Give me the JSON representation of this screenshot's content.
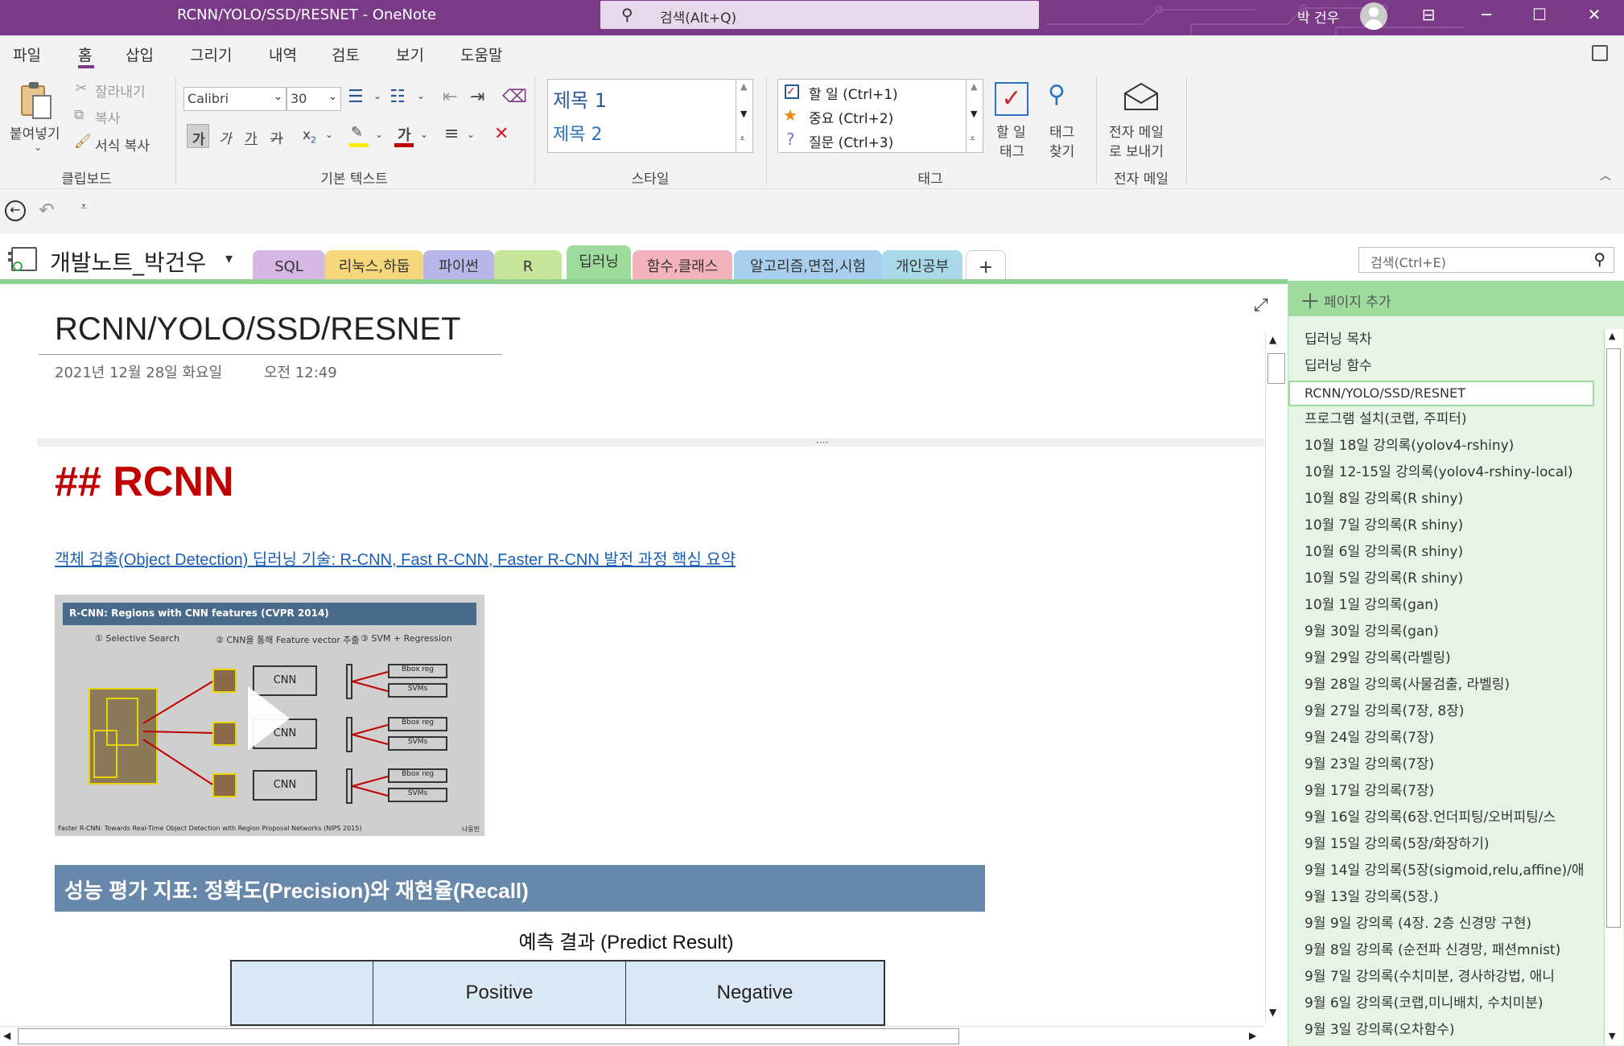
{
  "window": {
    "title": "RCNN/YOLO/SSD/RESNET  -  OneNote",
    "search_placeholder": "검색(Alt+Q)",
    "user": "박 건우"
  },
  "menu": [
    "파일",
    "홈",
    "삽입",
    "그리기",
    "내역",
    "검토",
    "보기",
    "도움말"
  ],
  "ribbon": {
    "clipboard": {
      "paste": "붙여넣기",
      "cut": "잘라내기",
      "copy": "복사",
      "format_painter": "서식 복사",
      "group": "클립보드"
    },
    "basic_text": {
      "font": "Calibri",
      "size": "30",
      "bold": "가",
      "italic": "가",
      "underline": "가",
      "strike": "가",
      "sub": "x",
      "group": "기본 텍스트"
    },
    "styles": {
      "h1": "제목 1",
      "h2": "제목 2",
      "group": "스타일"
    },
    "tags": {
      "todo": "할 일 (Ctrl+1)",
      "important": "중요 (Ctrl+2)",
      "question": "질문 (Ctrl+3)",
      "todo_tag_line1": "할 일",
      "todo_tag_line2": "태그",
      "find_tags_line1": "태그",
      "find_tags_line2": "찾기",
      "group": "태그"
    },
    "email": {
      "line1": "전자 메일",
      "line2": "로 보내기",
      "group": "전자 메일"
    }
  },
  "notebook": {
    "name": "개발노트_박건우",
    "sections": [
      {
        "label": "SQL",
        "color": "#d7b7e4"
      },
      {
        "label": "리눅스,하둡",
        "color": "#f6d77b"
      },
      {
        "label": "파이썬",
        "color": "#b8b5e9"
      },
      {
        "label": "R",
        "color": "#c6e59a"
      },
      {
        "label": "딥러닝",
        "color": "#9edc9e"
      },
      {
        "label": "함수,클래스",
        "color": "#f3b3bd"
      },
      {
        "label": "알고리즘,면접,시험",
        "color": "#a9cfee"
      },
      {
        "label": "개인공부",
        "color": "#a9d8e8"
      },
      {
        "label": "+",
        "color": "#ffffff"
      }
    ],
    "search_placeholder": "검색(Ctrl+E)"
  },
  "pagelist": {
    "add_page": "페이지 추가",
    "pages": [
      "딥러닝 목차",
      "딥러닝 함수",
      "RCNN/YOLO/SSD/RESNET",
      "프로그램 설치(코랩, 주피터)",
      "10월 18일 강의록(yolov4-rshiny)",
      "10월 12-15일 강의록(yolov4-rshiny-local)",
      "10월 8일 강의록(R shiny)",
      "10월 7일 강의록(R shiny)",
      "10월 6일 강의록(R shiny)",
      "10월 5일 강의록(R shiny)",
      "10월 1일 강의록(gan)",
      "9월 30일 강의록(gan)",
      "9월 29일 강의록(라벨링)",
      "9월 28일 강의록(사물검출, 라벨링)",
      "9월 27일 강의록(7장, 8장)",
      "9월 24일 강의록(7장)",
      "9월 23일 강의록(7장)",
      "9월 17일 강의록(7장)",
      "9월 16일 강의록(6장.언더피팅/오버피팅/스",
      "9월 15일 강의록(5장/화장하기)",
      "9월 14일 강의록(5장(sigmoid,relu,affine)/애",
      "9월 13일 강의록(5장.)",
      "9월 9일 강의록 (4장. 2층 신경망 구현)",
      "9월 8일 강의록 (순전파 신경망, 패션mnist)",
      "9월 7일 강의록(수치미분, 경사하강법, 애니",
      "9월 6일 강의록(코랩,미니배치, 수치미분)",
      "9월 3일 강의록(오차함수)"
    ],
    "current_index": 2
  },
  "page": {
    "title": "RCNN/YOLO/SSD/RESNET",
    "date": "2021년 12월 28일 화요일",
    "time": "오전 12:49",
    "heading": "## RCNN",
    "link": "객체 검출(Object Detection) 딥러닝 기술: R-CNN, Fast R-CNN, Faster R-CNN 발전 과정 핵심 요약",
    "video": {
      "header": "R-CNN: Regions with CNN features (CVPR 2014)",
      "step1": "① Selective Search",
      "step2": "② CNN을 통해 Feature vector 추출",
      "step3": "③ SVM + Regression",
      "cnn": "CNN",
      "bbox": "Bbox reg",
      "svms": "SVMs",
      "footer": "Faster R-CNN: Towards Real-Time Object Detection with Region Proposal Networks (NIPS 2015)",
      "author": "나동빈"
    },
    "banner": "성능 평가 지표: 정확도(Precision)와 재현율(Recall)",
    "table_caption": "예측 결과 (Predict Result)",
    "table_headers": [
      "",
      "Positive",
      "Negative"
    ]
  }
}
